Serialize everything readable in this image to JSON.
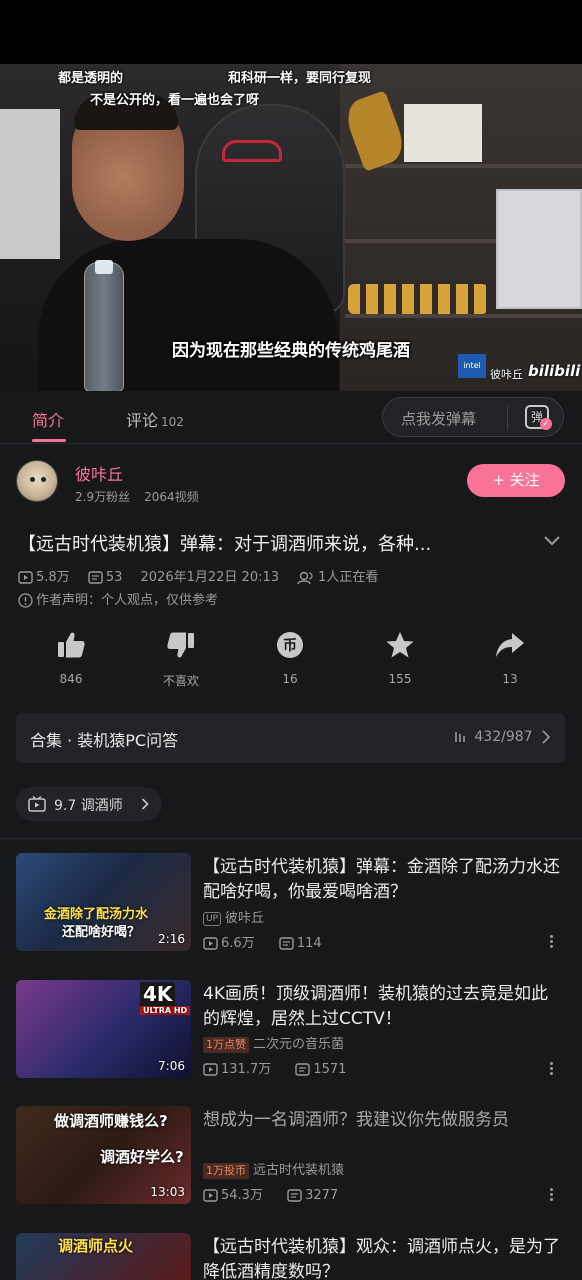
{
  "player": {
    "danmaku": [
      "都是透明的",
      "和科研一样，要同行复现",
      "不是公开的，看一遍也会了呀"
    ],
    "subtitle": "因为现在那些经典的传统鸡尾酒",
    "watermark_up": "彼咔丘",
    "watermark_logo": "bilibili",
    "intel_tag": "intel"
  },
  "tabs": {
    "intro": "简介",
    "comment": "评论",
    "comment_count": "102",
    "danmaku_placeholder": "点我发弹幕",
    "danmaku_icon": "弹"
  },
  "uploader": {
    "name": "彼咔丘",
    "fans": "2.9万粉丝",
    "videos": "2064视频",
    "follow": "+ 关注"
  },
  "video": {
    "title": "【远古时代装机猿】弹幕：对于调酒师来说，各种...",
    "views": "5.8万",
    "danmaku_count": "53",
    "date": "2026年1月22日 20:13",
    "watching": "1人正在看",
    "notice": "作者声明：个人观点，仅供参考"
  },
  "actions": [
    {
      "icon": "thumbs-up-icon",
      "label": "846"
    },
    {
      "icon": "thumbs-down-icon",
      "label": "不喜欢"
    },
    {
      "icon": "coin-icon",
      "label": "16"
    },
    {
      "icon": "star-icon",
      "label": "155"
    },
    {
      "icon": "share-icon",
      "label": "13"
    }
  ],
  "collection": {
    "title": "合集 · 装机猿PC问答",
    "count": "432/987"
  },
  "tag": {
    "label": "9.7 调酒师"
  },
  "related": [
    {
      "title": "【远古时代装机猿】弹幕：金酒除了配汤力水还配啥好喝，你最爱喝啥酒？",
      "badge": "UP",
      "author": "彼咔丘",
      "views": "6.6万",
      "danmaku": "114",
      "duration": "2:16",
      "caption_lines": [
        "金酒除了配汤力水",
        "还配啥好喝？"
      ]
    },
    {
      "title": "4K画质！顶级调酒师！装机猿的过去竟是如此的辉煌，居然上过CCTV！",
      "badge": "1万点赞",
      "author": "二次元の音乐菌",
      "views": "131.7万",
      "danmaku": "1571",
      "duration": "7:06",
      "caption_lines": [
        "4K",
        "ULTRA HD"
      ]
    },
    {
      "title": "想成为一名调酒师？我建议你先做服务员",
      "badge": "1万投币",
      "author": "远古时代装机猿",
      "views": "54.3万",
      "danmaku": "3277",
      "duration": "13:03",
      "caption_lines": [
        "做调酒师赚钱么?",
        "调酒好学么?"
      ]
    },
    {
      "title": "【远古时代装机猿】观众：调酒师点火，是为了降低酒精度数吗？",
      "caption_lines": [
        "调酒师点火"
      ]
    }
  ]
}
